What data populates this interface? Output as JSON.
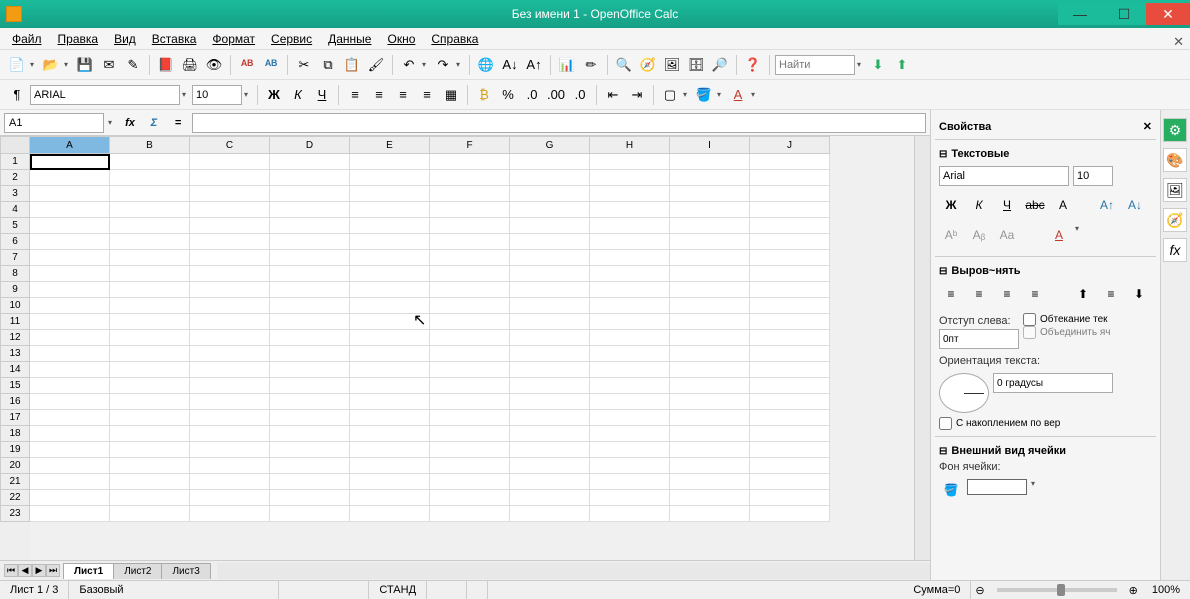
{
  "title": "Без имени 1 - OpenOffice Calc",
  "menus": [
    "Файл",
    "Правка",
    "Вид",
    "Вставка",
    "Формат",
    "Сервис",
    "Данные",
    "Окно",
    "Справка"
  ],
  "search_placeholder": "Найти",
  "font_name": "ARIAL",
  "font_size": "10",
  "cell_ref": "A1",
  "columns": [
    "A",
    "B",
    "C",
    "D",
    "E",
    "F",
    "G",
    "H",
    "I",
    "J"
  ],
  "rows": [
    1,
    2,
    3,
    4,
    5,
    6,
    7,
    8,
    9,
    10,
    11,
    12,
    13,
    14,
    15,
    16,
    17,
    18,
    19,
    20,
    21,
    22,
    23
  ],
  "selected_col": "A",
  "tabs": [
    "Лист1",
    "Лист2",
    "Лист3"
  ],
  "active_tab": "Лист1",
  "sidebar": {
    "title": "Свойства",
    "text_section": "Текстовые",
    "font_name": "Arial",
    "font_size": "10",
    "align_section": "Выров~нять",
    "indent_label": "Отступ слева:",
    "indent_value": "0пт",
    "wrap_label": "Обтекание тек",
    "merge_label": "Объединить яч",
    "orient_label": "Ориентация текста:",
    "angle_value": "0 градусы",
    "stack_label": "С накоплением по вер",
    "appearance_section": "Внешний вид ячейки",
    "fill_label": "Фон ячейки:"
  },
  "status": {
    "sheet": "Лист 1 / 3",
    "style": "Базовый",
    "mode": "СТАНД",
    "sum": "Сумма=0",
    "zoom": "100%"
  }
}
